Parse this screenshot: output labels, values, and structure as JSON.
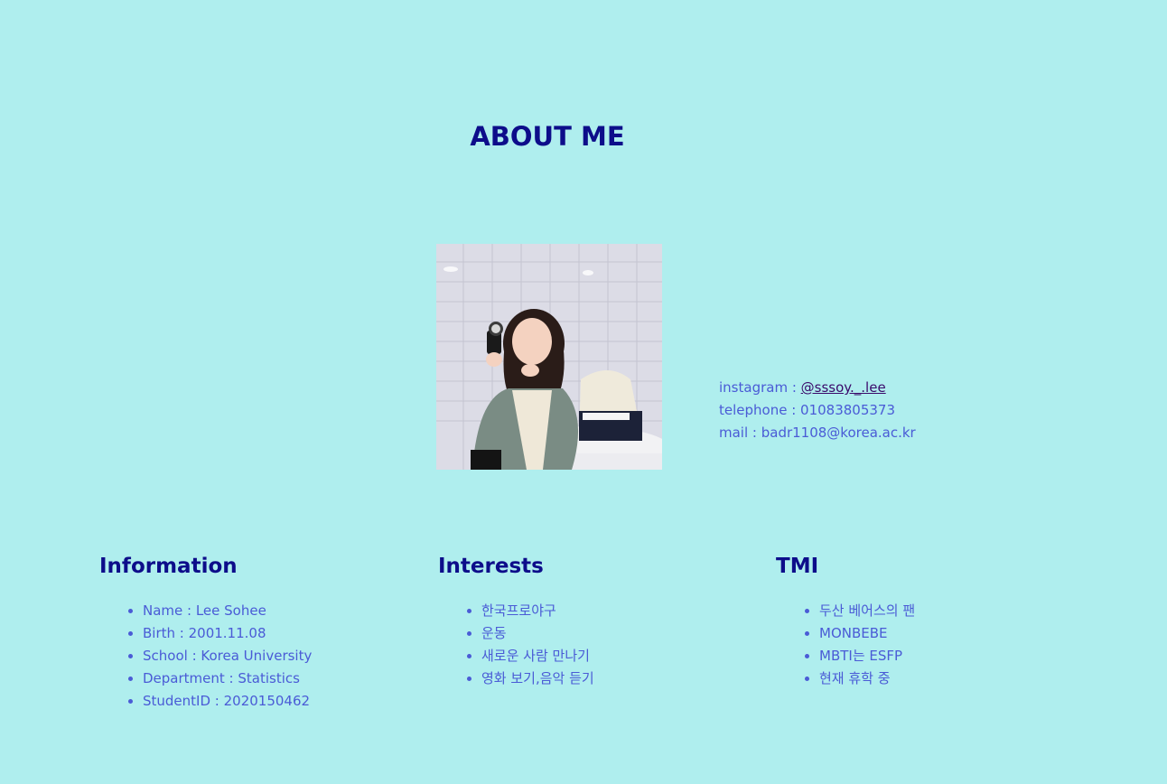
{
  "page": {
    "title": "ABOUT ME"
  },
  "profile": {
    "photo_icon": "profile-photo",
    "contact": {
      "instagram_label": "instagram : ",
      "instagram_handle": "@sssoy._.lee",
      "telephone": "telephone : 01083805373",
      "mail": "mail : badr1108@korea.ac.kr"
    }
  },
  "sections": {
    "information": {
      "title": "Information",
      "items": [
        "Name : Lee Sohee",
        "Birth : 2001.11.08",
        "School : Korea University",
        "Department : Statistics",
        "StudentID : 2020150462"
      ]
    },
    "interests": {
      "title": "Interests",
      "items": [
        "한국프로야구",
        "운동",
        "새로운 사람 만나기",
        "영화 보기,음악 듣기"
      ]
    },
    "tmi": {
      "title": "TMI",
      "items": [
        "두산 베어스의 팬",
        "MONBEBE",
        "MBTI는 ESFP",
        "현재 휴학 중"
      ]
    }
  },
  "colors": {
    "background": "#afeeee",
    "heading": "#0d0d8a",
    "text": "#4a5bd6",
    "link": "#3a0a6a"
  }
}
